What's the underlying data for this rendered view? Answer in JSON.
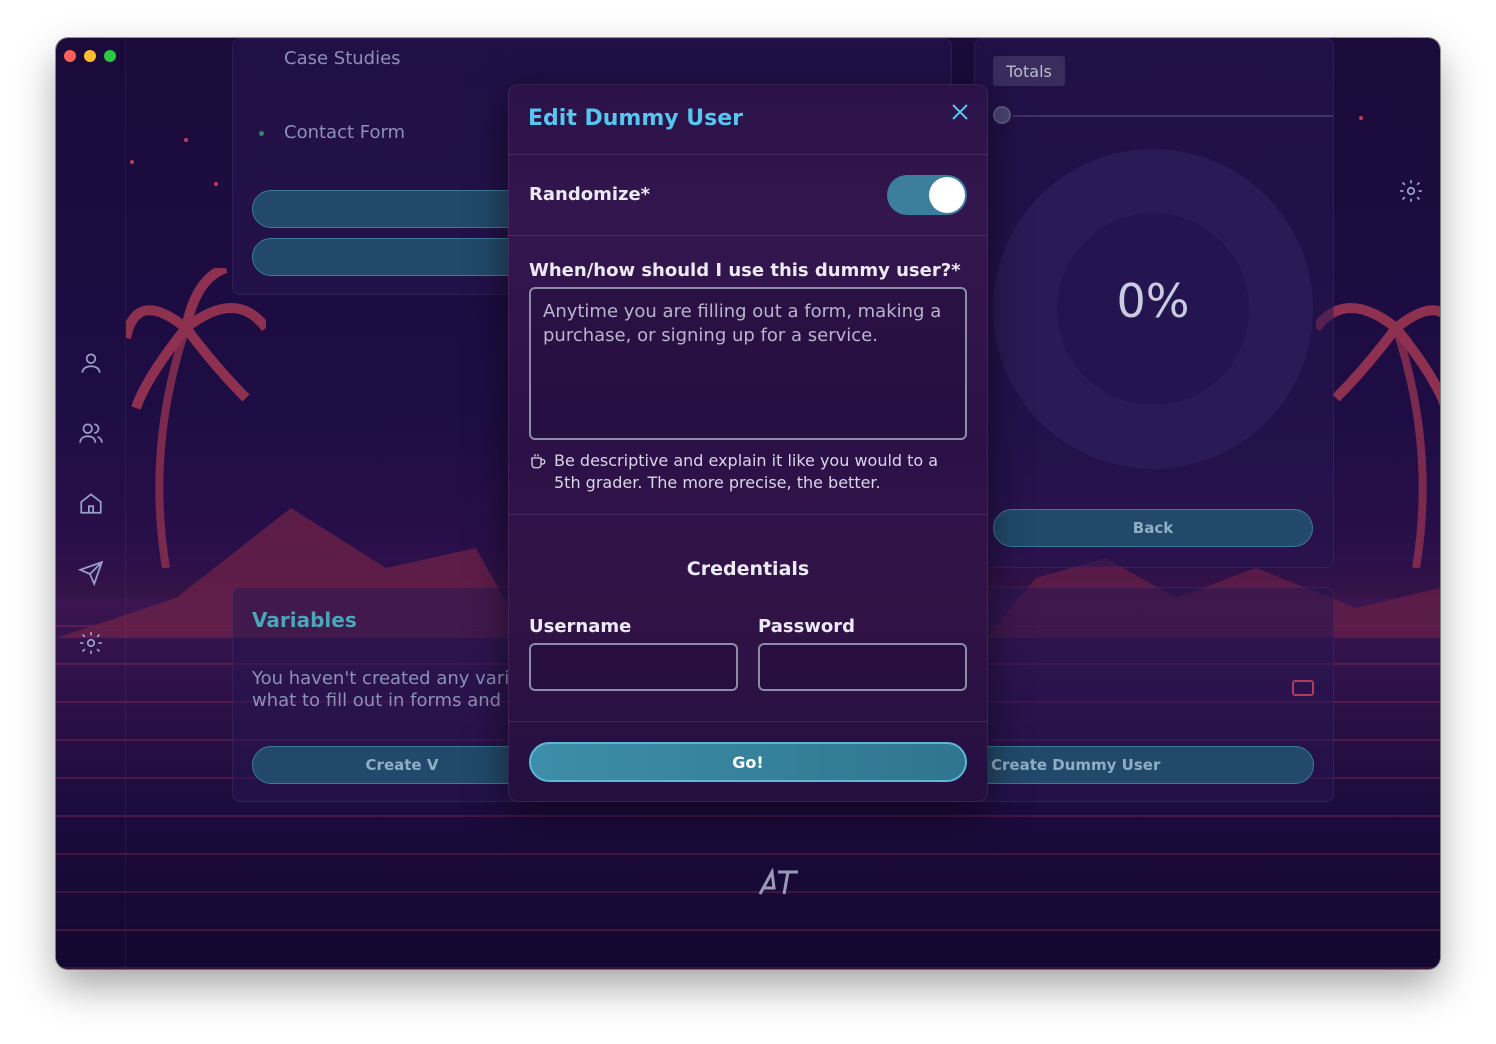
{
  "window": {
    "traffic_lights": [
      "close",
      "minimize",
      "maximize"
    ]
  },
  "sidebar": {
    "items": [
      {
        "icon": "user-icon"
      },
      {
        "icon": "users-icon"
      },
      {
        "icon": "home-icon"
      },
      {
        "icon": "send-icon"
      },
      {
        "icon": "gear-icon"
      }
    ]
  },
  "background": {
    "list_items": [
      "Case Studies",
      "Contact Form"
    ],
    "totals_label": "Totals",
    "percent": "0%",
    "back_button": "Back",
    "variables_title": "Variables",
    "variables_text_line1": "You haven't created any varia",
    "variables_text_line2": "what to fill out in forms and a",
    "create_variable_button": "Create V",
    "create_dummy_user_button": "Create Dummy User"
  },
  "modal": {
    "title": "Edit Dummy User",
    "randomize_label": "Randomize*",
    "randomize_on": true,
    "usage_label": "When/how should I use this dummy user?*",
    "usage_value": "Anytime you are filling out a form, making a purchase, or signing up for a service.",
    "hint": "Be descriptive and explain it like you would to a 5th grader. The more precise, the better.",
    "credentials_title": "Credentials",
    "username_label": "Username",
    "username_value": "",
    "password_label": "Password",
    "password_value": "",
    "go_button": "Go!"
  },
  "colors": {
    "accent": "#55c6ef",
    "toggle": "#3b7f9c",
    "button": "#3d8ea8",
    "background": "#1e0d44"
  }
}
